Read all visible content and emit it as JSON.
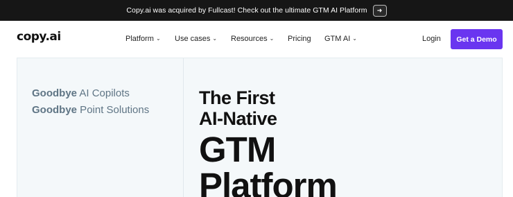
{
  "announcement": {
    "text": "Copy.ai was acquired by Fullcast! Check out the ultimate GTM AI Platform",
    "arrow_icon": "arrow-right-icon"
  },
  "header": {
    "logo": "copy.ai",
    "nav": [
      {
        "label": "Platform",
        "has_dropdown": true
      },
      {
        "label": "Use cases",
        "has_dropdown": true
      },
      {
        "label": "Resources",
        "has_dropdown": true
      },
      {
        "label": "Pricing",
        "has_dropdown": false
      },
      {
        "label": "GTM AI",
        "has_dropdown": true
      }
    ],
    "login": "Login",
    "cta": "Get a Demo",
    "cta_color": "#6a35f0"
  },
  "hero": {
    "goodbye_lines": [
      {
        "bold": "Goodbye",
        "rest": " AI Copilots"
      },
      {
        "bold": "Goodbye",
        "rest": " Point Solutions"
      }
    ],
    "headline": [
      "The First",
      "AI-Native",
      "GTM",
      "Platform"
    ]
  }
}
